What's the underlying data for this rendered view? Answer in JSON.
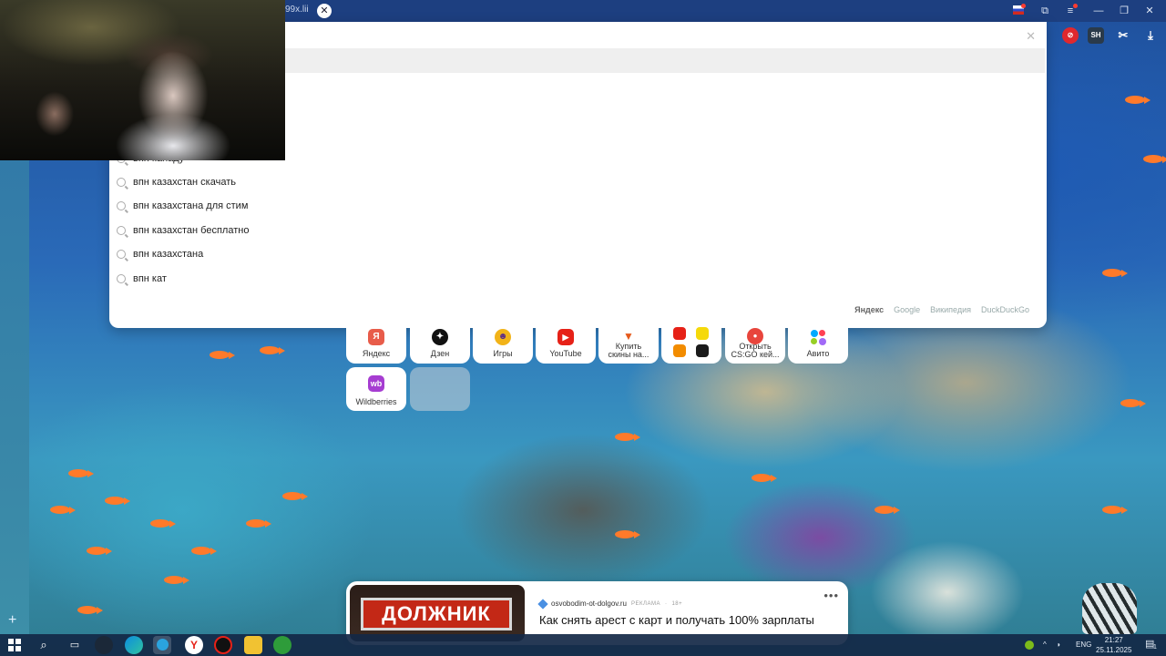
{
  "browser": {
    "tab_fragment": "99x.lii",
    "tab_close": "✕",
    "window_controls": [
      "—",
      "❐",
      "✕"
    ]
  },
  "right_icons": [
    {
      "name": "red-circle-extension-icon",
      "color": "#e0282e"
    },
    {
      "name": "sh-extension-icon",
      "text": "SH",
      "color": "#2a3a4a"
    },
    {
      "name": "screenshot-extension-icon",
      "color": "#ffffff"
    },
    {
      "name": "download-icon",
      "color": "#ffffff"
    }
  ],
  "suggestions": {
    "partial_item": "впн канаду",
    "items": [
      "впн казахстан скачать",
      "впн казахстана для стим",
      "впн казахстан бесплатно",
      "впн казахстана",
      "впн кат"
    ],
    "engines": [
      "Яндекс",
      "Google",
      "Википедия",
      "DuckDuckGo"
    ]
  },
  "tiles": [
    {
      "label": "Яндекс",
      "icon": "yandex-icon",
      "color": "#e85c4a",
      "glyph": "Я"
    },
    {
      "label": "Дзен",
      "icon": "dzen-icon",
      "color": "#111111",
      "glyph": "✦"
    },
    {
      "label": "Игры",
      "icon": "games-icon",
      "color": "#f2b318",
      "glyph": "☻"
    },
    {
      "label": "YouTube",
      "icon": "youtube-icon",
      "color": "#e62117",
      "glyph": "▶"
    },
    {
      "label": "Купить скины на...",
      "line1": "Купить",
      "line2": "скины на...",
      "icon": "fox-icon",
      "color": "#ffffff",
      "glyph": "🦊"
    },
    {
      "label": "",
      "icon": "folder-tile-icon",
      "color": "#ffffff"
    },
    {
      "label": "Открыть CS:GO кей...",
      "line1": "Открыть",
      "line2": "CS:GO кей...",
      "icon": "case-icon",
      "color": "#e8453c",
      "glyph": "●"
    },
    {
      "label": "Авито",
      "icon": "avito-icon",
      "color": "#ffffff",
      "glyph": "●"
    },
    {
      "label": "Wildberries",
      "icon": "wildberries-icon",
      "color": "#a63dd1",
      "glyph": "wb"
    }
  ],
  "ad": {
    "stamp_text": "ДОЛЖНИК",
    "domain": "osvobodim-ot-dolgov.ru",
    "ad_label": "РЕКЛАМА",
    "age": "18+",
    "title": "Как снять арест с карт и получать 100% зарплаты",
    "more": "•••"
  },
  "left_strip": {
    "plus": "+"
  },
  "taskbar": {
    "lang": "ENG",
    "time": "21:27",
    "date": "25.11.2025",
    "notif_count": "1"
  }
}
